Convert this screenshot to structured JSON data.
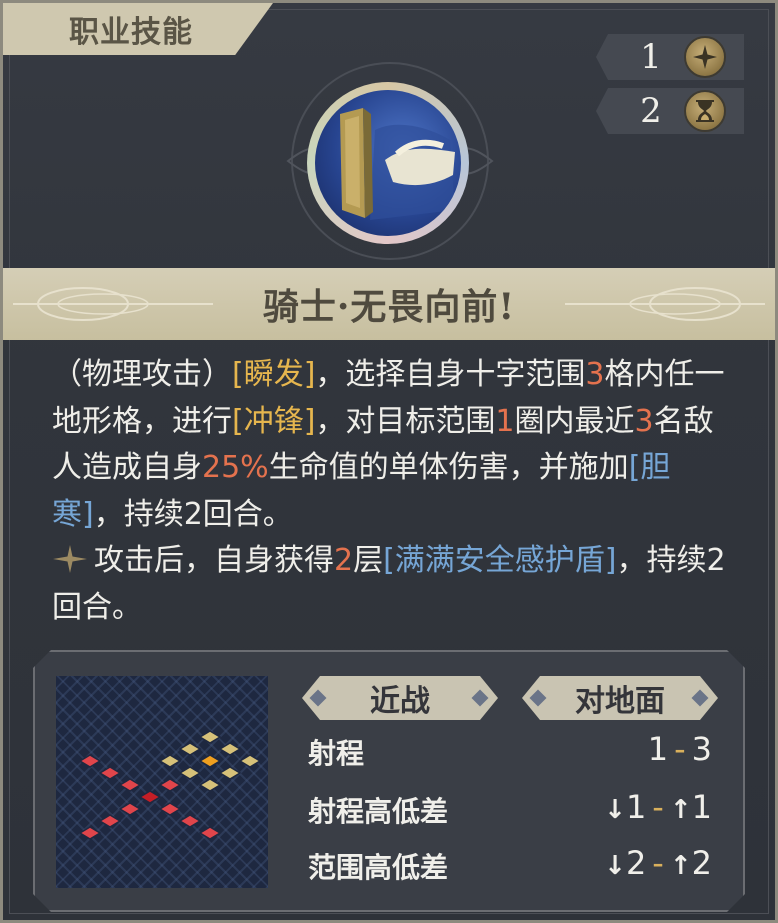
{
  "header": {
    "title": "职业技能"
  },
  "costs": [
    {
      "value": "1",
      "icon": "star-icon"
    },
    {
      "value": "2",
      "icon": "hourglass-icon"
    }
  ],
  "skill": {
    "name": "骑士·无畏向前!",
    "description": {
      "p1": "（物理攻击）",
      "b1": "[瞬发]",
      "p2": "，选择自身十字范围",
      "n1": "3",
      "p3": "格内任一地形格，进行",
      "b2": "[冲锋]",
      "p4": "，对目标范围",
      "n2": "1",
      "p5": "圈内最近",
      "n3": "3",
      "p6": "名敌人造成自身",
      "n4": "25%",
      "p7": "生命值的单体伤害，并施加",
      "b3": "[胆寒]",
      "p8": "，持续2回合。",
      "p9": "攻击后，自身获得",
      "n5": "2",
      "p10": "层",
      "b4": "[满满安全感护盾]",
      "p11": "，持续2回合。"
    }
  },
  "info": {
    "tags": [
      "近战",
      "对地面"
    ],
    "stats": [
      {
        "label": "射程",
        "min": "1",
        "max": "3",
        "min_arrow": "",
        "max_arrow": ""
      },
      {
        "label": "射程高低差",
        "min": "1",
        "max": "1",
        "min_arrow": "↓",
        "max_arrow": "↑"
      },
      {
        "label": "范围高低差",
        "min": "2",
        "max": "2",
        "min_arrow": "↓",
        "max_arrow": "↑"
      }
    ],
    "separator": "-"
  },
  "colors": {
    "accent_gold": "#e6b64e",
    "highlight_red": "#e4724e",
    "highlight_blue": "#76a6d6",
    "range_red": "#e0454b",
    "area_gold": "#d6c179",
    "center_orange": "#f0a020"
  }
}
